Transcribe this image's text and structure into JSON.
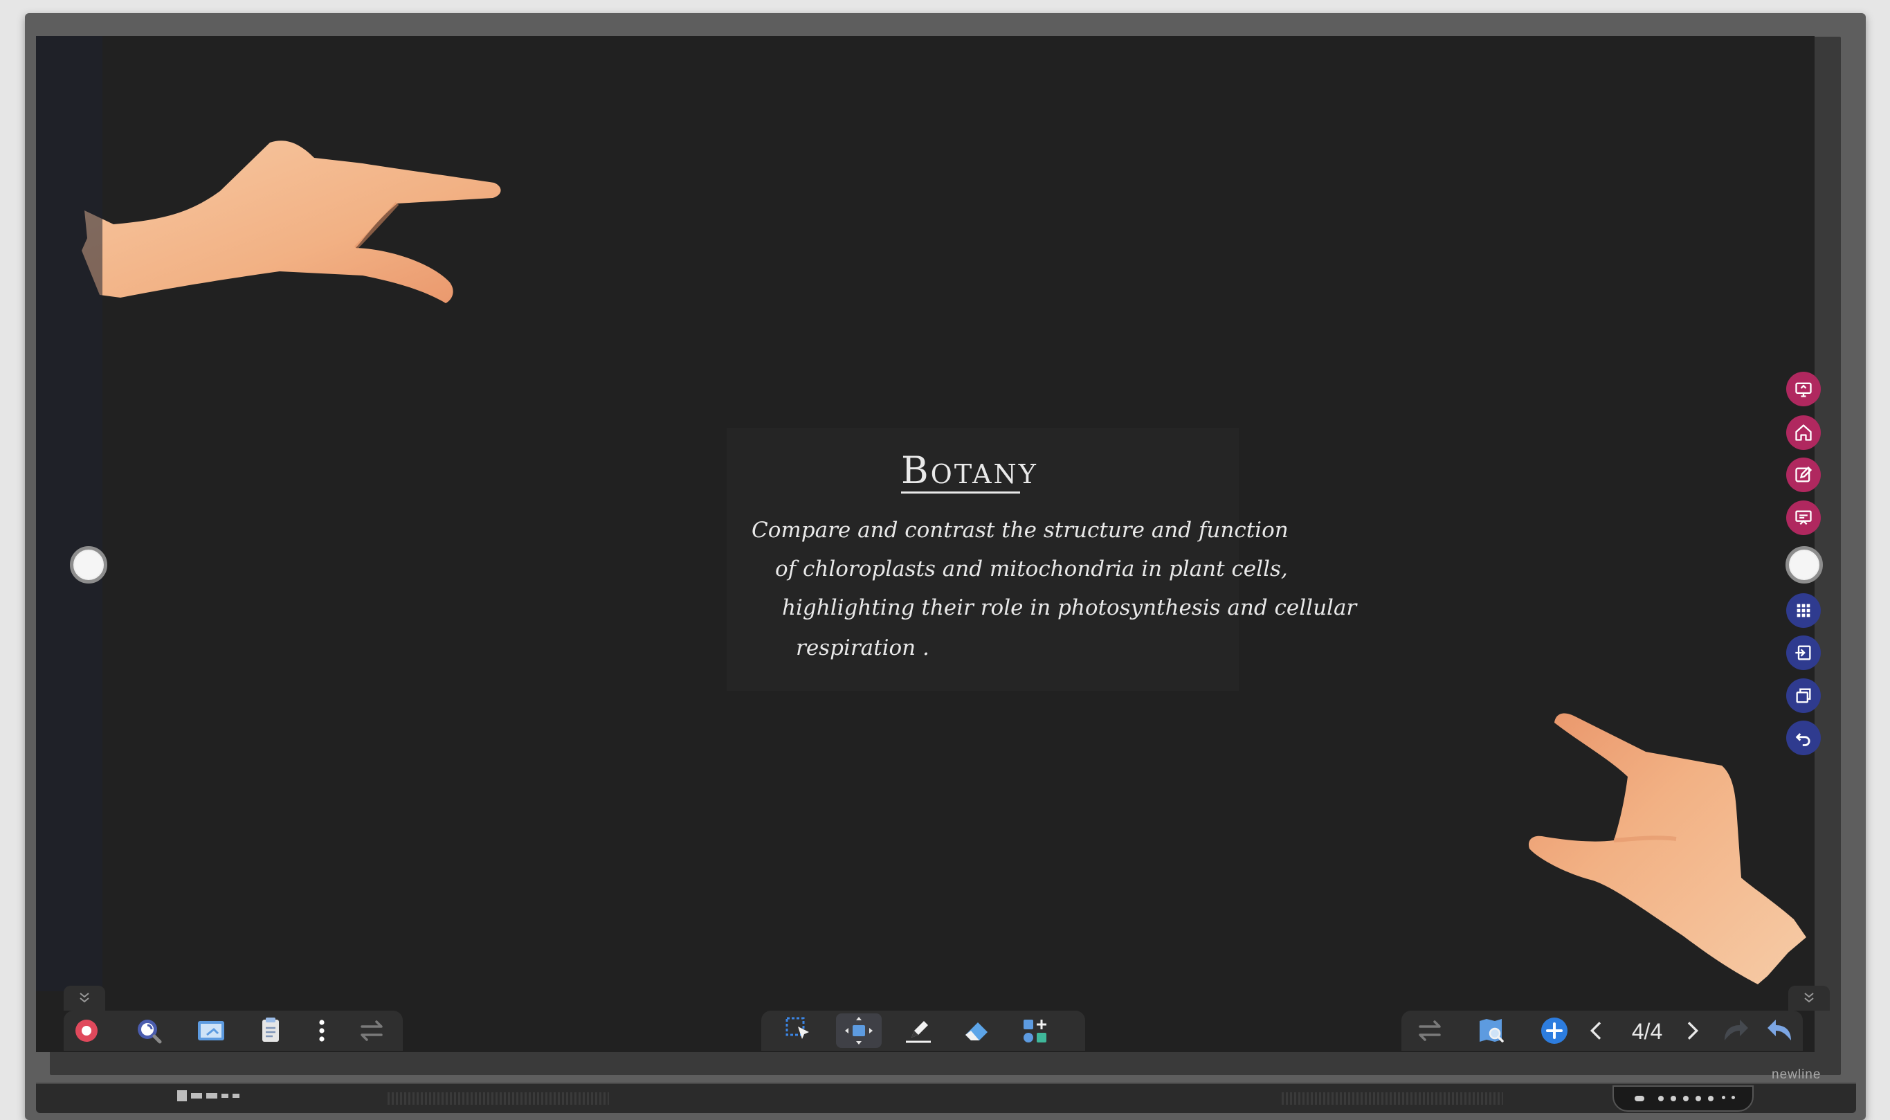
{
  "board": {
    "title": "Botany",
    "question_lines": [
      "Compare and contrast the structure and function",
      "of chloroplasts and mitochondria in plant cells,",
      "highlighting their role in photosynthesis and cellular",
      "respiration ."
    ]
  },
  "right_rail": {
    "items": [
      {
        "name": "screen-share",
        "icon": "screen-share-icon",
        "color": "#b0285f"
      },
      {
        "name": "home",
        "icon": "home-icon",
        "color": "#b0285f"
      },
      {
        "name": "annotate",
        "icon": "edit-icon",
        "color": "#b0285f"
      },
      {
        "name": "whiteboard",
        "icon": "whiteboard-icon",
        "color": "#b0285f"
      },
      {
        "name": "apps",
        "icon": "grid-icon",
        "color": "#2f3b8f"
      },
      {
        "name": "input-source",
        "icon": "input-icon",
        "color": "#2f3b8f"
      },
      {
        "name": "windows",
        "icon": "windows-icon",
        "color": "#2f3b8f"
      },
      {
        "name": "back",
        "icon": "back-icon",
        "color": "#2f3b8f"
      }
    ]
  },
  "toolbar_left": {
    "items": [
      "record-icon",
      "lens-icon",
      "screenshot-icon",
      "clipboard-icon",
      "more-icon",
      "swap-icon"
    ]
  },
  "toolbar_center": {
    "items": [
      "select-icon",
      "pan-icon",
      "pen-icon",
      "eraser-icon",
      "shapes-icon"
    ],
    "active": "pan-icon"
  },
  "toolbar_right": {
    "items": [
      "swap-icon",
      "page-preview-icon",
      "add-page-icon",
      "prev-page-icon",
      "next-page-icon",
      "redo-icon",
      "undo-icon"
    ],
    "page_indicator": "4/4"
  },
  "device": {
    "brand": "newline"
  },
  "colors": {
    "board_bg": "#212121",
    "accent_blue": "#2d7ddf",
    "record_red": "#e0495c",
    "toolbar_bg": "#2f2f2f",
    "rail_pink": "#b0285f",
    "rail_navy": "#2f3b8f"
  }
}
